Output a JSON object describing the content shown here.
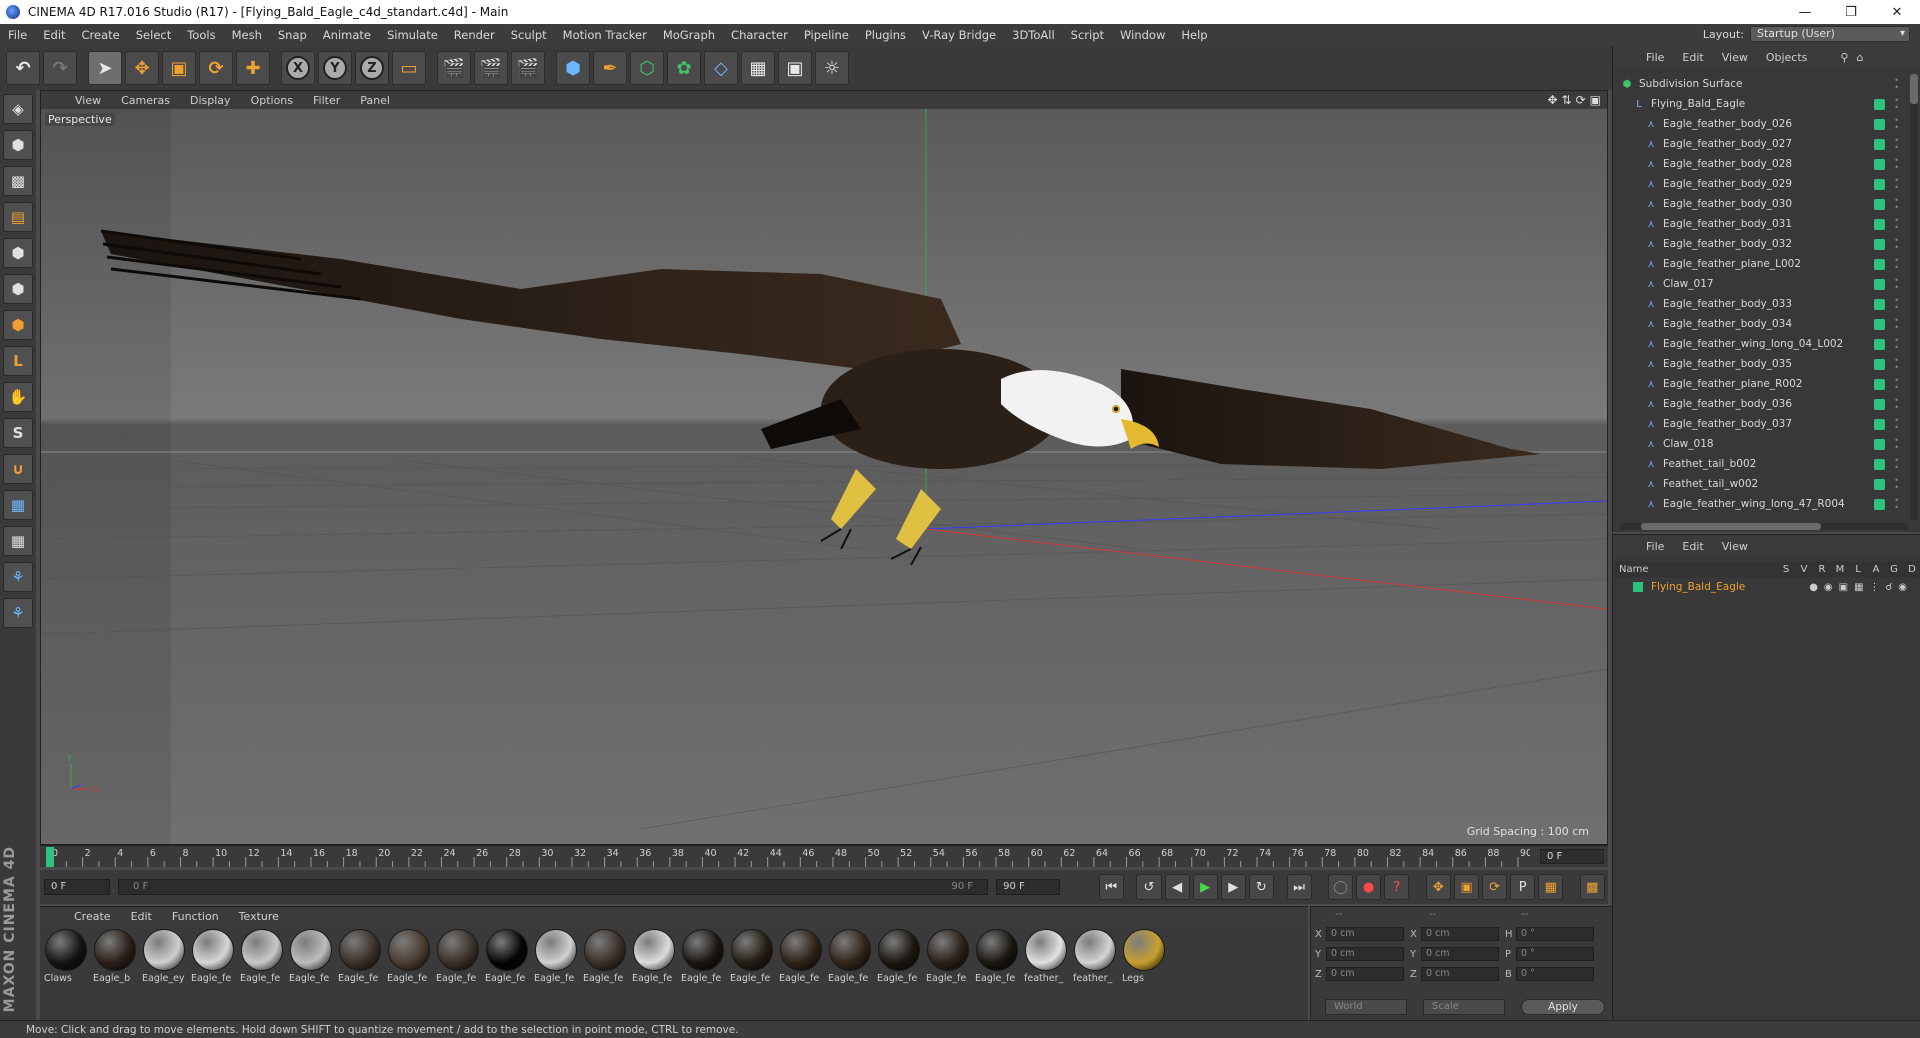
{
  "window": {
    "title": "CINEMA 4D R17.016 Studio (R17) - [Flying_Bald_Eagle_c4d_standart.c4d] - Main"
  },
  "menu": [
    "File",
    "Edit",
    "Create",
    "Select",
    "Tools",
    "Mesh",
    "Snap",
    "Animate",
    "Simulate",
    "Render",
    "Sculpt",
    "Motion Tracker",
    "MoGraph",
    "Character",
    "Pipeline",
    "Plugins",
    "V-Ray Bridge",
    "3DToAll",
    "Script",
    "Window",
    "Help"
  ],
  "layout": {
    "label": "Layout:",
    "value": "Startup (User)"
  },
  "viewport": {
    "menu": [
      "View",
      "Cameras",
      "Display",
      "Options",
      "Filter",
      "Panel"
    ],
    "label": "Perspective",
    "grid_spacing": "Grid Spacing : 100 cm"
  },
  "timeline": {
    "ticks": [
      "0",
      "2",
      "4",
      "6",
      "8",
      "10",
      "12",
      "14",
      "16",
      "18",
      "20",
      "22",
      "24",
      "26",
      "28",
      "30",
      "32",
      "34",
      "36",
      "38",
      "40",
      "42",
      "44",
      "46",
      "48",
      "50",
      "52",
      "54",
      "56",
      "58",
      "60",
      "62",
      "64",
      "66",
      "68",
      "70",
      "72",
      "74",
      "76",
      "78",
      "80",
      "82",
      "84",
      "86",
      "88",
      "90"
    ],
    "current_frame": "0 F"
  },
  "playback": {
    "start_field": "0 F",
    "range_start": "0 F",
    "range_end": "90 F",
    "end_field": "90 F"
  },
  "materials": {
    "menu": [
      "Create",
      "Edit",
      "Function",
      "Texture"
    ],
    "items": [
      {
        "label": "Claws",
        "color": "#141414"
      },
      {
        "label": "Eagle_b",
        "color": "#2a1f18"
      },
      {
        "label": "Eagle_ey",
        "color": "#cfcfcf"
      },
      {
        "label": "Eagle_fe",
        "color": "#d6d6d6"
      },
      {
        "label": "Eagle_fe",
        "color": "#c8c8c8"
      },
      {
        "label": "Eagle_fe",
        "color": "#bdbdbd"
      },
      {
        "label": "Eagle_fe",
        "color": "#3a3028"
      },
      {
        "label": "Eagle_fe",
        "color": "#4a3c30"
      },
      {
        "label": "Eagle_fe",
        "color": "#3a3028"
      },
      {
        "label": "Eagle_fe",
        "color": "#050505"
      },
      {
        "label": "Eagle_fe",
        "color": "#d0d0d0"
      },
      {
        "label": "Eagle_fe",
        "color": "#3a3028"
      },
      {
        "label": "Eagle_fe",
        "color": "#dcdcdc"
      },
      {
        "label": "Eagle_fe",
        "color": "#1a1510"
      },
      {
        "label": "Eagle_fe",
        "color": "#241c14"
      },
      {
        "label": "Eagle_fe",
        "color": "#2c2218"
      },
      {
        "label": "Eagle_fe",
        "color": "#302418"
      },
      {
        "label": "Eagle_fe",
        "color": "#1c1610"
      },
      {
        "label": "Eagle_fe",
        "color": "#2a2018"
      },
      {
        "label": "Eagle_fe",
        "color": "#1a1510"
      },
      {
        "label": "feather_",
        "color": "#e2e2e2"
      },
      {
        "label": "feather_",
        "color": "#d4d4d4"
      },
      {
        "label": "Legs",
        "color": "#c8a030"
      }
    ]
  },
  "coords": {
    "headers": [
      "--",
      "--",
      "--"
    ],
    "rows": [
      {
        "a": "X",
        "av": "0 cm",
        "b": "X",
        "bv": "0 cm",
        "c": "H",
        "cv": "0 °"
      },
      {
        "a": "Y",
        "av": "0 cm",
        "b": "Y",
        "bv": "0 cm",
        "c": "P",
        "cv": "0 °"
      },
      {
        "a": "Z",
        "av": "0 cm",
        "b": "Z",
        "bv": "0 cm",
        "c": "B",
        "cv": "0 °"
      }
    ],
    "world": "World",
    "scale": "Scale",
    "apply": "Apply"
  },
  "status": "Move: Click and drag to move elements. Hold down SHIFT to quantize movement / add to the selection in point mode, CTRL to remove.",
  "objects": {
    "menu": [
      "File",
      "Edit",
      "View",
      "Objects"
    ],
    "tree": [
      {
        "name": "Subdivision Surface",
        "depth": 0,
        "icon": "subdivision-icon"
      },
      {
        "name": "Flying_Bald_Eagle",
        "depth": 1,
        "icon": "null-object-icon"
      },
      {
        "name": "Eagle_feather_body_026",
        "depth": 2,
        "icon": "bone-icon"
      },
      {
        "name": "Eagle_feather_body_027",
        "depth": 2,
        "icon": "bone-icon"
      },
      {
        "name": "Eagle_feather_body_028",
        "depth": 2,
        "icon": "bone-icon"
      },
      {
        "name": "Eagle_feather_body_029",
        "depth": 2,
        "icon": "bone-icon"
      },
      {
        "name": "Eagle_feather_body_030",
        "depth": 2,
        "icon": "bone-icon"
      },
      {
        "name": "Eagle_feather_body_031",
        "depth": 2,
        "icon": "bone-icon"
      },
      {
        "name": "Eagle_feather_body_032",
        "depth": 2,
        "icon": "bone-icon"
      },
      {
        "name": "Eagle_feather_plane_L002",
        "depth": 2,
        "icon": "bone-icon"
      },
      {
        "name": "Claw_017",
        "depth": 2,
        "icon": "bone-icon"
      },
      {
        "name": "Eagle_feather_body_033",
        "depth": 2,
        "icon": "bone-icon"
      },
      {
        "name": "Eagle_feather_body_034",
        "depth": 2,
        "icon": "bone-icon"
      },
      {
        "name": "Eagle_feather_wing_long_04_L002",
        "depth": 2,
        "icon": "bone-icon"
      },
      {
        "name": "Eagle_feather_body_035",
        "depth": 2,
        "icon": "bone-icon"
      },
      {
        "name": "Eagle_feather_plane_R002",
        "depth": 2,
        "icon": "bone-icon"
      },
      {
        "name": "Eagle_feather_body_036",
        "depth": 2,
        "icon": "bone-icon"
      },
      {
        "name": "Eagle_feather_body_037",
        "depth": 2,
        "icon": "bone-icon"
      },
      {
        "name": "Claw_018",
        "depth": 2,
        "icon": "bone-icon"
      },
      {
        "name": "Feathet_tail_b002",
        "depth": 2,
        "icon": "bone-icon"
      },
      {
        "name": "Feathet_tail_w002",
        "depth": 2,
        "icon": "bone-icon"
      },
      {
        "name": "Eagle_feather_wing_long_47_R004",
        "depth": 2,
        "icon": "bone-icon"
      }
    ]
  },
  "layers": {
    "menu": [
      "File",
      "Edit",
      "View"
    ],
    "headers": {
      "name": "Name",
      "cols": [
        "S",
        "V",
        "R",
        "M",
        "L",
        "A",
        "G",
        "D"
      ]
    },
    "row": {
      "name": "Flying_Bald_Eagle",
      "color": "#2ec27e"
    }
  },
  "colors": {
    "accent": "#f0a030",
    "tag": "#2ec27e",
    "play": "#44dd44"
  }
}
